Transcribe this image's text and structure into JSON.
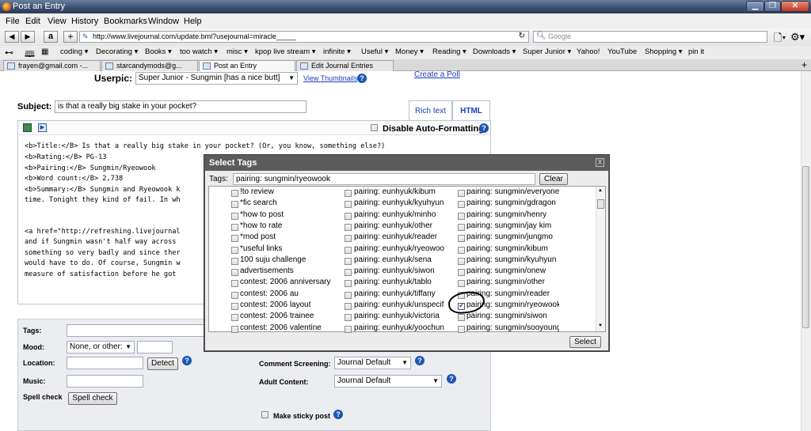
{
  "window": {
    "title": "Post an Entry"
  },
  "menu": [
    "File",
    "Edit",
    "View",
    "History",
    "Bookmarks",
    "Window",
    "Help"
  ],
  "nav": {
    "url": "http://www.livejournal.com/update.bml?usejournal=miracle_____",
    "search_placeholder": "Google"
  },
  "bookmarks": [
    "coding ▾",
    "Decorating ▾",
    "Books ▾",
    "too watch ▾",
    "misc ▾",
    "kpop live stream ▾",
    "infinite ▾",
    "Useful ▾",
    "Money ▾",
    "Reading ▾",
    "Downloads ▾",
    "Super Junior ▾",
    "Yahoo!",
    "YouTube",
    "Shopping ▾",
    "pin it"
  ],
  "tabs": [
    "frayen@gmail.com -...",
    "starcandymods@g...",
    "Post an Entry",
    "Edit Journal Entries"
  ],
  "form": {
    "userpic_label": "Userpic:",
    "userpic_value": "Super Junior - Sungmin [has a nice butt]",
    "view_thumbnails": "View Thumbnails",
    "create_poll": "Create a Poll",
    "subject_label": "Subject:",
    "subject_value": "is that a really big stake in your pocket?",
    "tab_rich": "Rich text",
    "tab_html": "HTML",
    "disable_autoformat": "Disable Auto-Formatting",
    "body_lines": [
      "<b>Title:</B> Is that a really big stake in your pocket? (Or, you know, something else?)",
      "<b>Rating:</B> PG-13",
      "<b>Pairing:</B> Sungmin/Ryeowook",
      "<b>Word count:</B> 2,738",
      "<b>Summary:</B> Sungmin and Ryeowook k",
      "time. Tonight they kind of fail. In wh",
      "",
      "",
      "<a href=\"http://refreshing.livejournal",
      "and if Sungmin wasn't half way across",
      "something so very badly and since ther",
      "would have to do. Of course, Sungmin w",
      "measure of satisfaction before he got"
    ],
    "tags_label": "Tags:",
    "mood_label": "Mood:",
    "mood_value": "None, or other:",
    "location_label": "Location:",
    "detect": "Detect",
    "music_label": "Music:",
    "spellcheck_label": "Spell check",
    "spellcheck_button": "Spell check",
    "comment_screening_label": "Comment Screening:",
    "comment_screening_value": "Journal Default",
    "adult_label": "Adult Content:",
    "adult_value": "Journal Default",
    "sticky_label": "Make sticky post"
  },
  "modal": {
    "title": "Select Tags",
    "tags_label": "Tags:",
    "tags_value": "pairing: sungmin/ryeowook",
    "clear": "Clear",
    "select": "Select",
    "close": "X",
    "col1": [
      "!to review",
      "*fic search",
      "*how to post",
      "*how to rate",
      "*mod post",
      "*useful links",
      "100 suju challenge",
      "advertisements",
      "contest: 2006 anniversary",
      "contest: 2006 au",
      "contest: 2006 layout",
      "contest: 2006 trainee",
      "contest: 2006 valentine"
    ],
    "col2": [
      "pairing: eunhyuk/kibum",
      "pairing: eunhyuk/kyuhyun",
      "pairing: eunhyuk/minho",
      "pairing: eunhyuk/other",
      "pairing: eunhyuk/reader",
      "pairing: eunhyuk/ryeowook",
      "pairing: eunhyuk/sena",
      "pairing: eunhyuk/siwon",
      "pairing: eunhyuk/tablo",
      "pairing: eunhyuk/tiffany",
      "pairing: eunhyuk/unspecified",
      "pairing: eunhyuk/victoria",
      "pairing: eunhyuk/yoochun"
    ],
    "col3": [
      "pairing: sungmin/everyone",
      "pairing: sungmin/gdragon",
      "pairing: sungmin/henry",
      "pairing: sungmin/jay kim",
      "pairing: sungmin/jungmo",
      "pairing: sungmin/kibum",
      "pairing: sungmin/kyuhyun",
      "pairing: sungmin/onew",
      "pairing: sungmin/other",
      "pairing: sungmin/reader",
      "pairing: sungmin/ryeowook",
      "pairing: sungmin/siwon",
      "pairing: sungmin/sooyoung"
    ],
    "checked": "col3.10"
  }
}
